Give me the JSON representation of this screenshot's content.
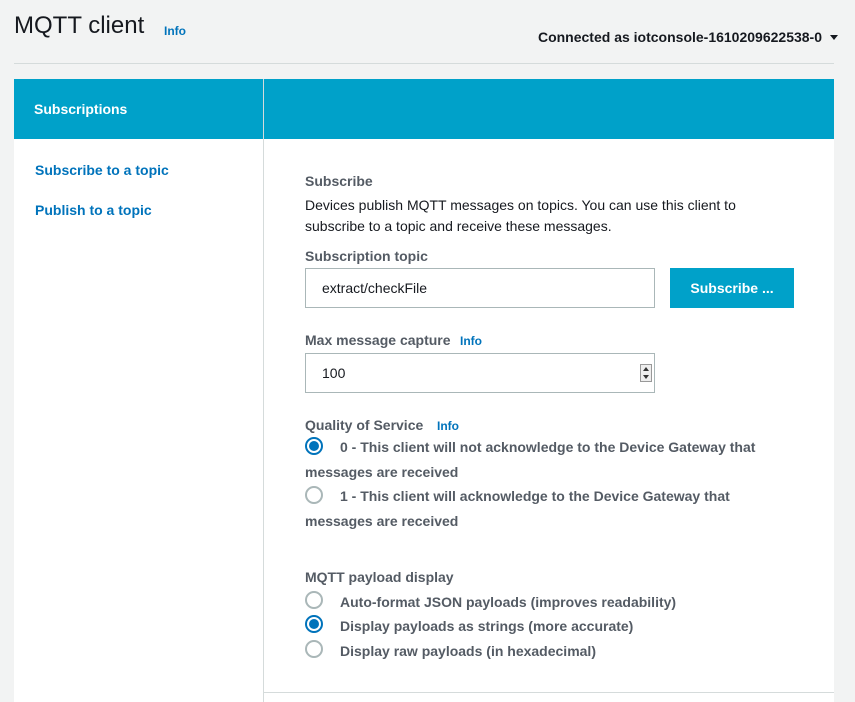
{
  "header": {
    "title": "MQTT client",
    "info": "Info",
    "connected": "Connected as iotconsole-1610209622538-0"
  },
  "sidebar": {
    "title": "Subscriptions",
    "links": [
      "Subscribe to a topic",
      "Publish to a topic"
    ]
  },
  "subscribe": {
    "section_label": "Subscribe",
    "description": "Devices publish MQTT messages on topics. You can use this client to subscribe to a topic and receive these messages.",
    "topic_label": "Subscription topic",
    "topic_value": "extract/checkFile",
    "button": "Subscribe ...",
    "max_label": "Max message capture",
    "max_info": "Info",
    "max_value": "100"
  },
  "qos": {
    "label": "Quality of Service",
    "info": "Info",
    "options": [
      {
        "text": "0 - This client will not acknowledge to the Device Gateway that messages are received",
        "selected": true
      },
      {
        "text": "1 - This client will acknowledge to the Device Gateway that messages are received",
        "selected": false
      }
    ]
  },
  "payload": {
    "label": "MQTT payload display",
    "options": [
      {
        "text": "Auto-format JSON payloads (improves readability)",
        "selected": false
      },
      {
        "text": "Display payloads as strings (more accurate)",
        "selected": true
      },
      {
        "text": "Display raw payloads (in hexadecimal)",
        "selected": false
      }
    ]
  },
  "colors": {
    "accent": "#00a1c9",
    "link": "#0073bb"
  }
}
